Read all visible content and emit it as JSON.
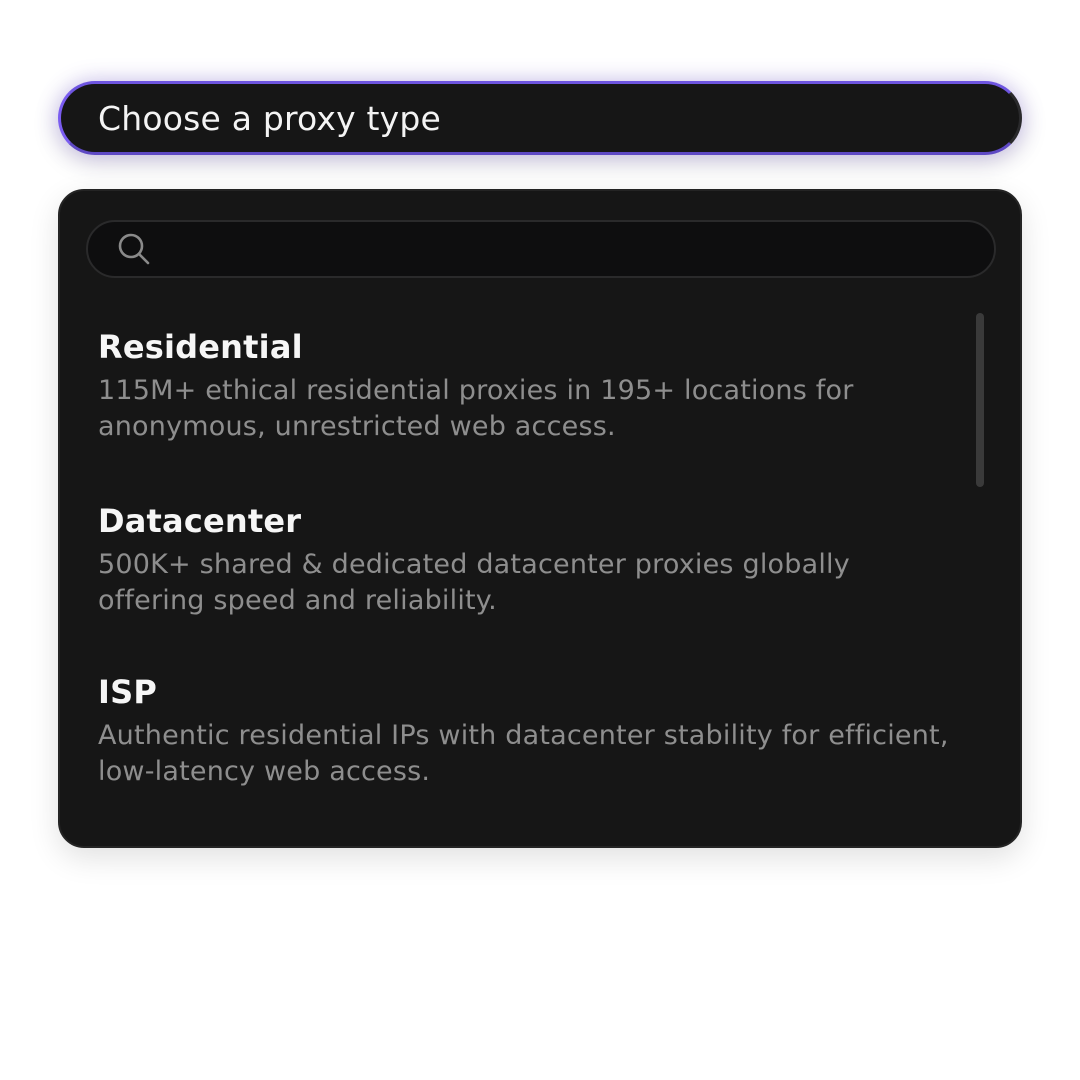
{
  "select": {
    "label": "Choose a proxy type",
    "accent_color": "#7a5cf0"
  },
  "search": {
    "placeholder": "",
    "value": "",
    "icon": "search-icon"
  },
  "options": [
    {
      "title": "Residential",
      "description": "115M+ ethical residential proxies in 195+ locations for anonymous, unrestricted web access."
    },
    {
      "title": "Datacenter",
      "description": "500K+ shared & dedicated datacenter proxies globally offering speed and reliability."
    },
    {
      "title": "ISP",
      "description": "Authentic residential IPs with datacenter stability for efficient, low-latency web access."
    }
  ]
}
